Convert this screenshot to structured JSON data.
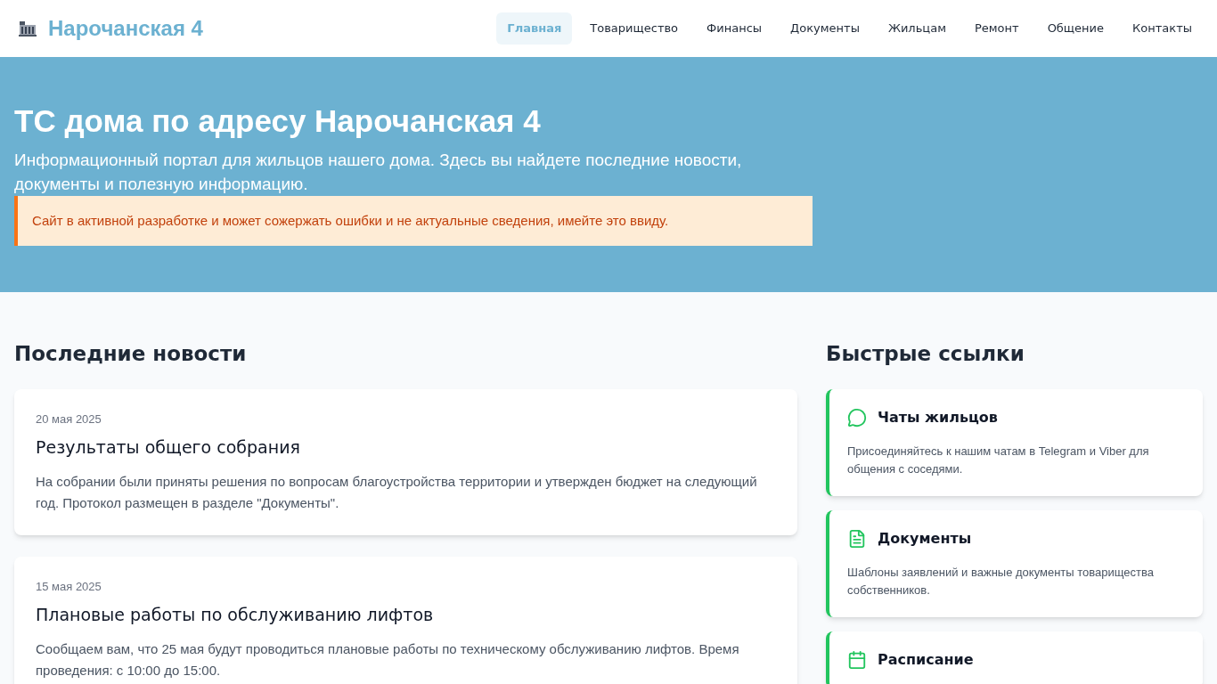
{
  "header": {
    "logo_text": "Нарочанская 4"
  },
  "nav": [
    {
      "label": "Главная",
      "selected": true
    },
    {
      "label": "Товарищество",
      "selected": false
    },
    {
      "label": "Финансы",
      "selected": false
    },
    {
      "label": "Документы",
      "selected": false
    },
    {
      "label": "Жильцам",
      "selected": false
    },
    {
      "label": "Ремонт",
      "selected": false
    },
    {
      "label": "Общение",
      "selected": false
    },
    {
      "label": "Контакты",
      "selected": false
    }
  ],
  "hero": {
    "title": "ТС дома по адресу Нарочанская 4",
    "subtitle": "Информационный портал для жильцов нашего дома. Здесь вы найдете последние новости, документы и полезную информацию.",
    "notice": "Сайт в активной разработке и может сожержать ошибки и не актуальные сведения, имейте это ввиду."
  },
  "news": {
    "heading": "Последние новости",
    "items": [
      {
        "date": "20 мая 2025",
        "title": "Результаты общего собрания",
        "text": "На собрании были приняты решения по вопросам благоустройства территории и утвержден бюджет на следующий год. Протокол размещен в разделе \"Документы\"."
      },
      {
        "date": "15 мая 2025",
        "title": "Плановые работы по обслуживанию лифтов",
        "text": "Сообщаем вам, что 25 мая будут проводиться плановые работы по техническому обслуживанию лифтов. Время проведения: с 10:00 до 15:00."
      }
    ]
  },
  "quick_links": {
    "heading": "Быстрые ссылки",
    "items": [
      {
        "kind": "chat",
        "title": "Чаты жильцов",
        "text": "Присоединяйтесь к нашим чатам в Telegram и Viber для общения с соседями."
      },
      {
        "kind": "document",
        "title": "Документы",
        "text": "Шаблоны заявлений и важные документы товарищества собственников."
      },
      {
        "kind": "calendar",
        "title": "Расписание"
      }
    ]
  }
}
